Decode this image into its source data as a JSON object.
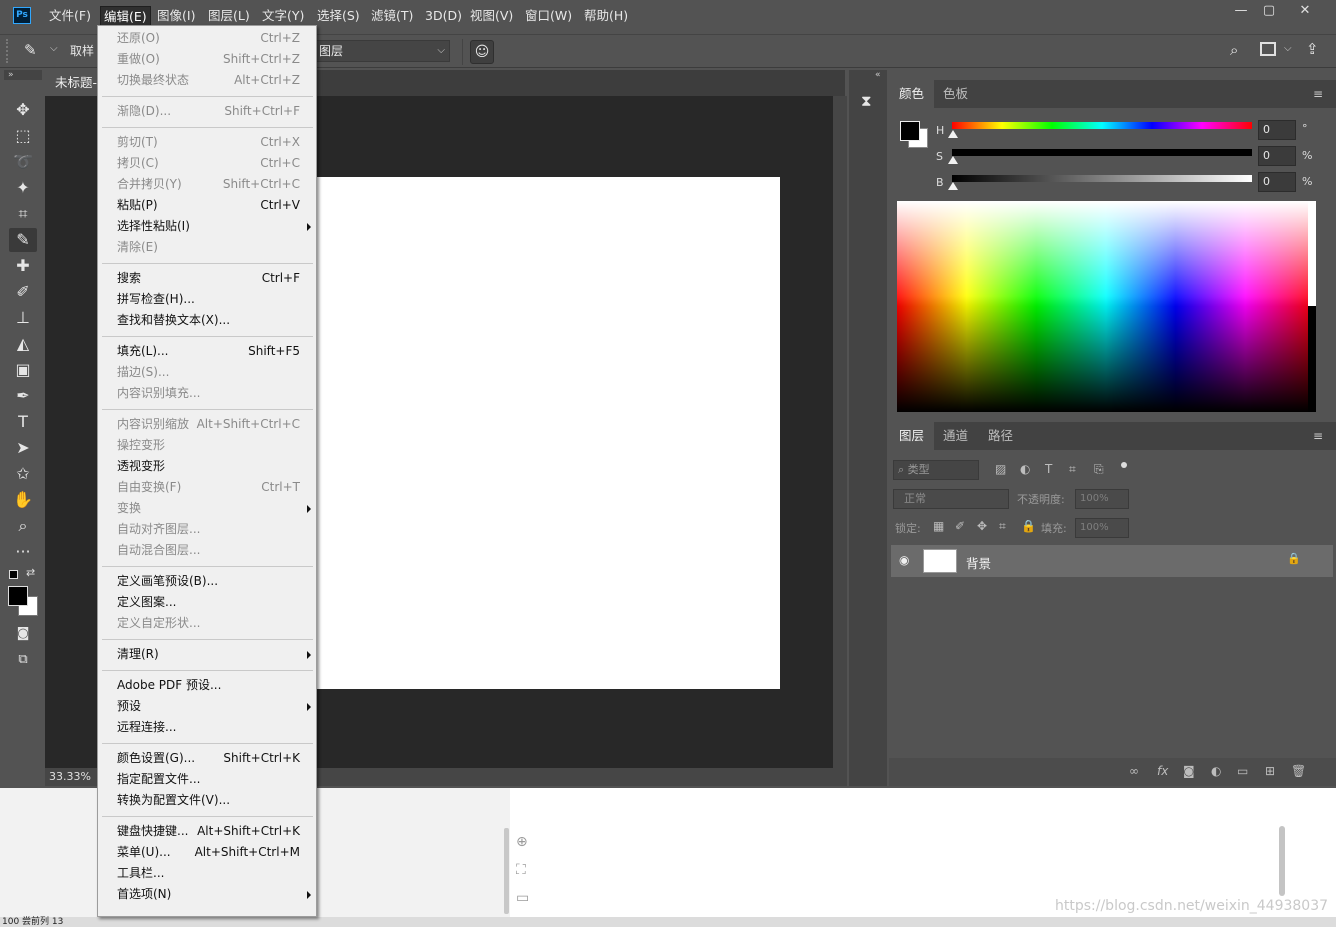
{
  "app": {
    "logo": "Ps"
  },
  "menubar": {
    "items": [
      "文件(F)",
      "编辑(E)",
      "图像(I)",
      "图层(L)",
      "文字(Y)",
      "选择(S)",
      "滤镜(T)",
      "3D(D)",
      "视图(V)",
      "窗口(W)",
      "帮助(H)"
    ],
    "active": "编辑(E)",
    "window_controls": {
      "minimize": "—",
      "restore": "▢",
      "close": "✕"
    }
  },
  "options_bar": {
    "sample_label": "取样",
    "layer_select_value": "图层"
  },
  "document": {
    "tab_title": "未标题-",
    "zoom": "33.33%"
  },
  "edit_menu": {
    "groups": [
      [
        {
          "label": "还原(O)",
          "shortcut": "Ctrl+Z",
          "disabled": true
        },
        {
          "label": "重做(O)",
          "shortcut": "Shift+Ctrl+Z",
          "disabled": true
        },
        {
          "label": "切换最终状态",
          "shortcut": "Alt+Ctrl+Z",
          "disabled": true
        }
      ],
      [
        {
          "label": "渐隐(D)...",
          "shortcut": "Shift+Ctrl+F",
          "disabled": true
        }
      ],
      [
        {
          "label": "剪切(T)",
          "shortcut": "Ctrl+X",
          "disabled": true
        },
        {
          "label": "拷贝(C)",
          "shortcut": "Ctrl+C",
          "disabled": true
        },
        {
          "label": "合并拷贝(Y)",
          "shortcut": "Shift+Ctrl+C",
          "disabled": true
        },
        {
          "label": "粘贴(P)",
          "shortcut": "Ctrl+V",
          "disabled": false
        },
        {
          "label": "选择性粘贴(I)",
          "shortcut": "",
          "disabled": false,
          "submenu": true
        },
        {
          "label": "清除(E)",
          "shortcut": "",
          "disabled": true
        }
      ],
      [
        {
          "label": "搜索",
          "shortcut": "Ctrl+F",
          "disabled": false
        },
        {
          "label": "拼写检查(H)...",
          "shortcut": "",
          "disabled": false
        },
        {
          "label": "查找和替换文本(X)...",
          "shortcut": "",
          "disabled": false
        }
      ],
      [
        {
          "label": "填充(L)...",
          "shortcut": "Shift+F5",
          "disabled": false
        },
        {
          "label": "描边(S)...",
          "shortcut": "",
          "disabled": true
        },
        {
          "label": "内容识别填充...",
          "shortcut": "",
          "disabled": true
        }
      ],
      [
        {
          "label": "内容识别缩放",
          "shortcut": "Alt+Shift+Ctrl+C",
          "disabled": true
        },
        {
          "label": "操控变形",
          "shortcut": "",
          "disabled": true
        },
        {
          "label": "透视变形",
          "shortcut": "",
          "disabled": false
        },
        {
          "label": "自由变换(F)",
          "shortcut": "Ctrl+T",
          "disabled": true
        },
        {
          "label": "变换",
          "shortcut": "",
          "disabled": true,
          "submenu": true
        },
        {
          "label": "自动对齐图层...",
          "shortcut": "",
          "disabled": true
        },
        {
          "label": "自动混合图层...",
          "shortcut": "",
          "disabled": true
        }
      ],
      [
        {
          "label": "定义画笔预设(B)...",
          "shortcut": "",
          "disabled": false
        },
        {
          "label": "定义图案...",
          "shortcut": "",
          "disabled": false
        },
        {
          "label": "定义自定形状...",
          "shortcut": "",
          "disabled": true
        }
      ],
      [
        {
          "label": "清理(R)",
          "shortcut": "",
          "disabled": false,
          "submenu": true
        }
      ],
      [
        {
          "label": "Adobe PDF 预设...",
          "shortcut": "",
          "disabled": false
        },
        {
          "label": "预设",
          "shortcut": "",
          "disabled": false,
          "submenu": true
        },
        {
          "label": "远程连接...",
          "shortcut": "",
          "disabled": false
        }
      ],
      [
        {
          "label": "颜色设置(G)...",
          "shortcut": "Shift+Ctrl+K",
          "disabled": false
        },
        {
          "label": "指定配置文件...",
          "shortcut": "",
          "disabled": false
        },
        {
          "label": "转换为配置文件(V)...",
          "shortcut": "",
          "disabled": false
        }
      ],
      [
        {
          "label": "键盘快捷键...",
          "shortcut": "Alt+Shift+Ctrl+K",
          "disabled": false
        },
        {
          "label": "菜单(U)...",
          "shortcut": "Alt+Shift+Ctrl+M",
          "disabled": false
        },
        {
          "label": "工具栏...",
          "shortcut": "",
          "disabled": false
        },
        {
          "label": "首选项(N)",
          "shortcut": "",
          "disabled": false,
          "submenu": true
        }
      ]
    ]
  },
  "color_panel": {
    "tabs": [
      "颜色",
      "色板"
    ],
    "active_tab": "颜色",
    "sliders": [
      {
        "label": "H",
        "value": "0",
        "unit": "°"
      },
      {
        "label": "S",
        "value": "0",
        "unit": "%"
      },
      {
        "label": "B",
        "value": "0",
        "unit": "%"
      }
    ],
    "foreground": "#000000",
    "background": "#ffffff"
  },
  "layers_panel": {
    "tabs": [
      "图层",
      "通道",
      "路径"
    ],
    "active_tab": "图层",
    "filter_placeholder": "类型",
    "blend_mode": "正常",
    "opacity_label": "不透明度:",
    "opacity_value": "100%",
    "lock_label": "锁定:",
    "fill_label": "填充:",
    "fill_value": "100%",
    "layers": [
      {
        "name": "背景",
        "visible": true,
        "locked": true
      }
    ]
  },
  "status_line": "100  尝前列 13",
  "watermark": "https://blog.csdn.net/weixin_44938037"
}
